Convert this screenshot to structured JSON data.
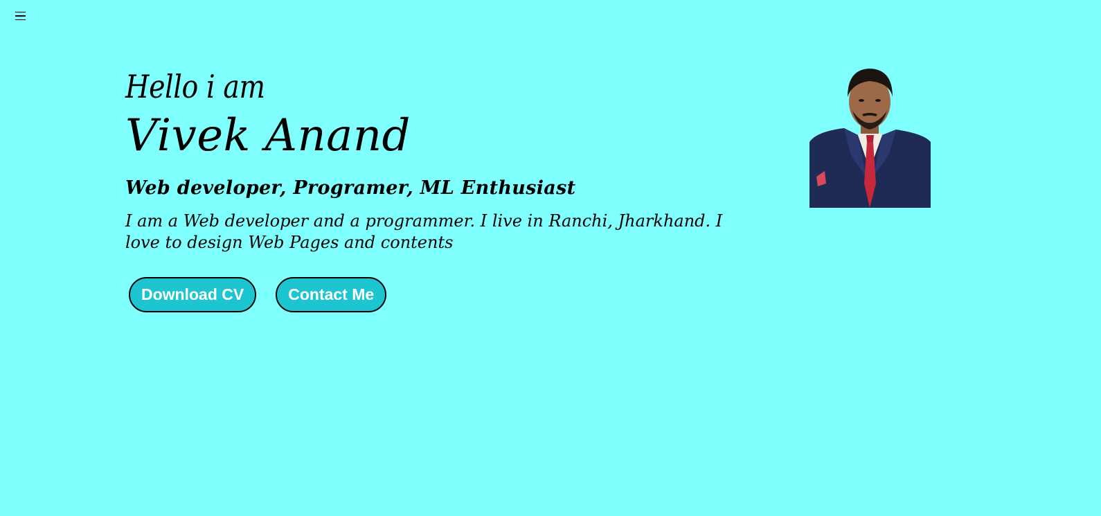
{
  "nav": {
    "menu_icon": "hamburger-menu-icon"
  },
  "hero": {
    "greeting": "Hello i am",
    "name": "Vivek Anand",
    "roles": "Web developer, Programer, ML Enthusiast",
    "bio": "I am a Web developer and a programmer. I live in Ranchi, Jharkhand. I love to design Web Pages and contents",
    "buttons": {
      "download_cv": "Download CV",
      "contact_me": "Contact Me"
    }
  },
  "colors": {
    "background": "#80ffff",
    "button_fill": "#1cc5cf",
    "button_text": "#ffffff"
  }
}
